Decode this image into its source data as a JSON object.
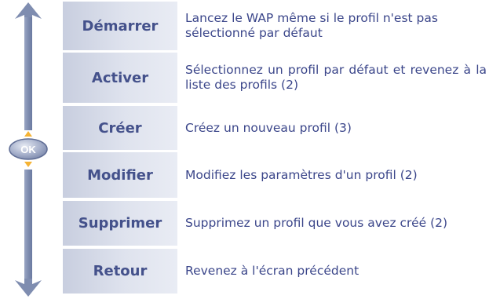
{
  "colors": {
    "label_text": "#44518b",
    "desc_text": "#3b468a",
    "label_bg_dark": "#c8cedf",
    "label_bg_light": "#e9ecf4",
    "nav_arrow": "#7f8db0",
    "ok_button": "#8f9bbf",
    "ok_highlight": "#f5b335"
  },
  "nav": {
    "ok_label": "OK",
    "up_icon": "arrow-up-icon",
    "down_icon": "arrow-down-icon"
  },
  "rows": [
    {
      "label": "Démarrer",
      "description": "Lancez le WAP même si le profil n'est pas sélectionné par défaut"
    },
    {
      "label": "Activer",
      "description": "Sélectionnez un profil par défaut et revenez à la liste des profils (2)"
    },
    {
      "label": "Créer",
      "description": "Créez un nouveau profil (3)"
    },
    {
      "label": "Modifier",
      "description": "Modifiez les paramètres d'un profil (2)"
    },
    {
      "label": "Supprimer",
      "description": "Supprimez un profil que vous avez créé (2)"
    },
    {
      "label": "Retour",
      "description": "Revenez à l'écran précédent"
    }
  ]
}
